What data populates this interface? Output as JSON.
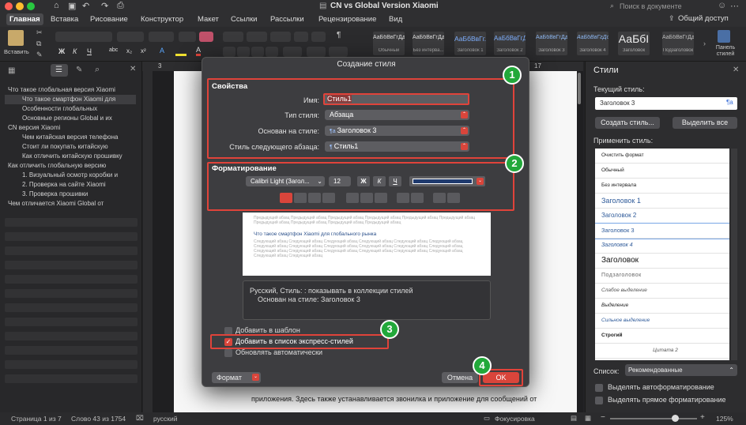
{
  "window": {
    "title": "CN vs Global Version Xiaomi",
    "search_placeholder": "Поиск в документе"
  },
  "tabs": [
    "Главная",
    "Вставка",
    "Рисование",
    "Конструктор",
    "Макет",
    "Ссылки",
    "Рассылки",
    "Рецензирование",
    "Вид"
  ],
  "share_label": "Общий доступ",
  "ribbon": {
    "paste_label": "Вставить",
    "gallery": [
      {
        "preview": "АаБбВвГгДд",
        "name": "Обычный"
      },
      {
        "preview": "АаБбВвГгДд",
        "name": "Без интерва..."
      },
      {
        "preview": "АаБбВвГг.",
        "name": "Заголовок 1"
      },
      {
        "preview": "АаБбВвГгД",
        "name": "Заголовок 2"
      },
      {
        "preview": "АаБбВвГгДд",
        "name": "Заголовок 3"
      },
      {
        "preview": "АаБбВвГгДд",
        "name": "Заголовок 4"
      },
      {
        "preview": "АаБбI",
        "name": "Заголовок"
      },
      {
        "preview": "АаБбВвГгДд",
        "name": "Подзаголовок"
      }
    ],
    "styles_pane_label": "Панель стилей"
  },
  "nav": {
    "items": [
      {
        "text": "Что такое глобальная версия Xiaomi",
        "level": 0
      },
      {
        "text": "Что такое смартфон Xiaomi для",
        "level": 1,
        "selected": true
      },
      {
        "text": "Особенности глобальных",
        "level": 1
      },
      {
        "text": "Основные регионы Global и их",
        "level": 1
      },
      {
        "text": "CN версия Xiaomi",
        "level": 0
      },
      {
        "text": "Чем китайская версия телефона",
        "level": 1
      },
      {
        "text": "Стоит ли покупать китайскую",
        "level": 1
      },
      {
        "text": "Как отличить китайскую прошивку",
        "level": 1
      },
      {
        "text": "Как отличить глобальную версию",
        "level": 0
      },
      {
        "text": "1. Визуальный осмотр коробки и",
        "level": 1
      },
      {
        "text": "2. Проверка на сайте Xiaomi",
        "level": 1
      },
      {
        "text": "3. Проверка прошивки",
        "level": 1
      },
      {
        "text": "Чем отличается Xiaomi Global от",
        "level": 0
      }
    ]
  },
  "ruler": {
    "left_mark": "3",
    "right_mark": "17"
  },
  "dialog": {
    "title": "Создание стиля",
    "properties": {
      "heading": "Свойства",
      "name_label": "Имя:",
      "name_value": "Стиль1",
      "type_label": "Тип стиля:",
      "type_value": "Абзаца",
      "based_label": "Основан на стиле:",
      "based_value": "Заголовок 3",
      "next_label": "Стиль следующего абзаца:",
      "next_value": "Стиль1"
    },
    "formatting": {
      "heading": "Форматирование",
      "font": "Calibri Light (Загол...",
      "size": "12",
      "bold": "Ж",
      "italic": "К",
      "underline": "Ч",
      "color": "#1f3a6e"
    },
    "preview": {
      "gray_text": "Предыдущий абзац Предыдущий абзац Предыдущий абзац Предыдущий абзац Предыдущий абзац",
      "sample": "Что такое смартфон Xiaomi для глобального рынка",
      "following_text": "Следующий абзац Следующий абзац Следующий абзац Следующий абзац Следующий абзац"
    },
    "description_line1": "Русский, Стиль: : показывать в коллекции стилей",
    "description_line2": "Основан на стиле: Заголовок 3",
    "add_to_template": "Добавить в шаблон",
    "add_to_quick": "Добавить в список экспресс-стилей",
    "auto_update": "Обновлять автоматически",
    "format_button": "Формат",
    "cancel": "Отмена",
    "ok": "OK"
  },
  "badges": [
    "1",
    "2",
    "3",
    "4"
  ],
  "doc_text": "приложения. Здесь также устанавливается звонилка и приложение для сообщений от",
  "styles_pane": {
    "title": "Стили",
    "current_label": "Текущий стиль:",
    "current_value": "Заголовок 3",
    "create_button": "Создать стиль...",
    "select_all_button": "Выделить все",
    "apply_label": "Применить стиль:",
    "items": [
      "Очистить формат",
      "Обычный",
      "Без интервала",
      "Заголовок 1",
      "Заголовок 2",
      "Заголовок 3",
      "Заголовок 4",
      "Заголовок",
      "Подзаголовок",
      "Слабое выделение",
      "Выделение",
      "Сильное выделение",
      "Строгий",
      "Цитата 2"
    ],
    "list_label": "Список:",
    "list_value": "Рекомендованные",
    "show_formatting": "Выделять автоформатирование",
    "show_direct": "Выделять прямое форматирование"
  },
  "status": {
    "page": "Страница 1 из 7",
    "words": "Слово 43 из 1754",
    "language": "русский",
    "focus": "Фокусировка",
    "zoom": "125%"
  },
  "colors": {
    "accent": "#e0433a",
    "badge": "#22a83a"
  }
}
